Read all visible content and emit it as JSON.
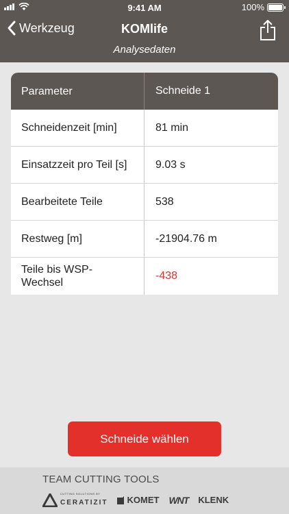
{
  "status_bar": {
    "time": "9:41 AM",
    "battery": "100%"
  },
  "nav": {
    "back_label": "Werkzeug",
    "title": "KOMlife",
    "subtitle": "Analysedaten"
  },
  "table": {
    "headers": [
      "Parameter",
      "Schneide 1"
    ],
    "rows": [
      {
        "label": "Schneidenzeit [min]",
        "value": "81 min"
      },
      {
        "label": "Einsatzzeit pro Teil [s]",
        "value": "9.03 s"
      },
      {
        "label": "Bearbeitete Teile",
        "value": "538"
      },
      {
        "label": "Restweg [m]",
        "value": "-21904.76 m"
      },
      {
        "label": "Teile bis WSP-Wechsel",
        "value": "-438",
        "value_color": "#e3302b"
      }
    ]
  },
  "action": {
    "select_label": "Schneide wählen"
  },
  "footer": {
    "heading": "TEAM CUTTING TOOLS",
    "logos": {
      "ceratizit_small": "CUTTING SOLUTIONS BY",
      "ceratizit": "CERATIZIT",
      "komet": "KOMET",
      "wnt": "WNT",
      "klenk": "KLENK"
    }
  },
  "colors": {
    "header_bg": "#5d5754",
    "accent_red": "#e3302b",
    "page_bg": "#e7e7e7"
  }
}
